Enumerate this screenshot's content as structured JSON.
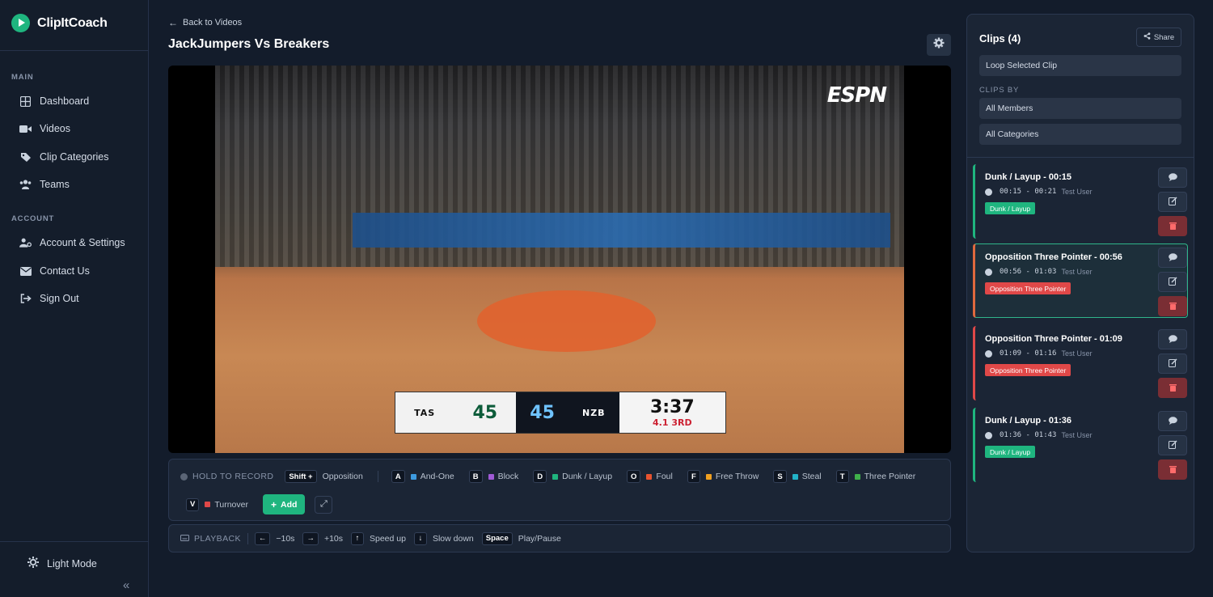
{
  "app": {
    "name": "ClipItCoach"
  },
  "sidebar": {
    "main_section": "MAIN",
    "main_items": [
      {
        "label": "Dashboard",
        "icon": "grid-icon"
      },
      {
        "label": "Videos",
        "icon": "video-camera-icon"
      },
      {
        "label": "Clip Categories",
        "icon": "tags-icon"
      },
      {
        "label": "Teams",
        "icon": "users-icon"
      }
    ],
    "account_section": "ACCOUNT",
    "account_items": [
      {
        "label": "Account & Settings",
        "icon": "user-gear-icon"
      },
      {
        "label": "Contact Us",
        "icon": "envelope-icon"
      },
      {
        "label": "Sign Out",
        "icon": "sign-out-icon"
      }
    ],
    "light_mode": "Light Mode",
    "collapse": "«"
  },
  "header": {
    "back": "Back to Videos",
    "title": "JackJumpers Vs Breakers"
  },
  "video": {
    "watermark": "ESPN",
    "scorebug": {
      "home_abbr": "TAS",
      "home_score": "45",
      "away_score": "45",
      "away_abbr": "NZB",
      "clock": "3:37",
      "period": "4.1 3RD"
    }
  },
  "hotkeys": {
    "hold_label": "HOLD TO RECORD",
    "shift_key": "Shift +",
    "shift_label": "Opposition",
    "items": [
      {
        "key": "A",
        "label": "And-One",
        "color": "#3d9be0"
      },
      {
        "key": "B",
        "label": "Block",
        "color": "#a05ad6"
      },
      {
        "key": "D",
        "label": "Dunk / Layup",
        "color": "#1fb57f"
      },
      {
        "key": "O",
        "label": "Foul",
        "color": "#e8532f"
      },
      {
        "key": "F",
        "label": "Free Throw",
        "color": "#f0a020"
      },
      {
        "key": "S",
        "label": "Steal",
        "color": "#22b3c8"
      },
      {
        "key": "T",
        "label": "Three Pointer",
        "color": "#3fb04a"
      },
      {
        "key": "V",
        "label": "Turnover",
        "color": "#e04848"
      }
    ],
    "add_label": "Add"
  },
  "playback": {
    "label": "PLAYBACK",
    "items": [
      {
        "key": "←",
        "label": "−10s"
      },
      {
        "key": "→",
        "label": "+10s"
      },
      {
        "key": "↑",
        "label": "Speed up"
      },
      {
        "key": "↓",
        "label": "Slow down"
      },
      {
        "key": "Space",
        "label": "Play/Pause"
      }
    ]
  },
  "clips_panel": {
    "title": "Clips (4)",
    "share": "Share",
    "loop": "Loop Selected Clip",
    "clips_by": "CLIPS BY",
    "members": "All Members",
    "categories": "All Categories",
    "clips": [
      {
        "title": "Dunk / Layup - 00:15",
        "start": "00:15",
        "end": "00:21",
        "user": "Test User",
        "tag": "Dunk / Layup",
        "color": "#1fb57f",
        "active": false
      },
      {
        "title": "Opposition Three Pointer - 00:56",
        "start": "00:56",
        "end": "01:03",
        "user": "Test User",
        "tag": "Opposition Three Pointer",
        "color": "#e04848",
        "active": true
      },
      {
        "title": "Opposition Three Pointer - 01:09",
        "start": "01:09",
        "end": "01:16",
        "user": "Test User",
        "tag": "Opposition Three Pointer",
        "color": "#e04848",
        "active": false
      },
      {
        "title": "Dunk / Layup - 01:36",
        "start": "01:36",
        "end": "01:43",
        "user": "Test User",
        "tag": "Dunk / Layup",
        "color": "#1fb57f",
        "active": false
      }
    ]
  }
}
